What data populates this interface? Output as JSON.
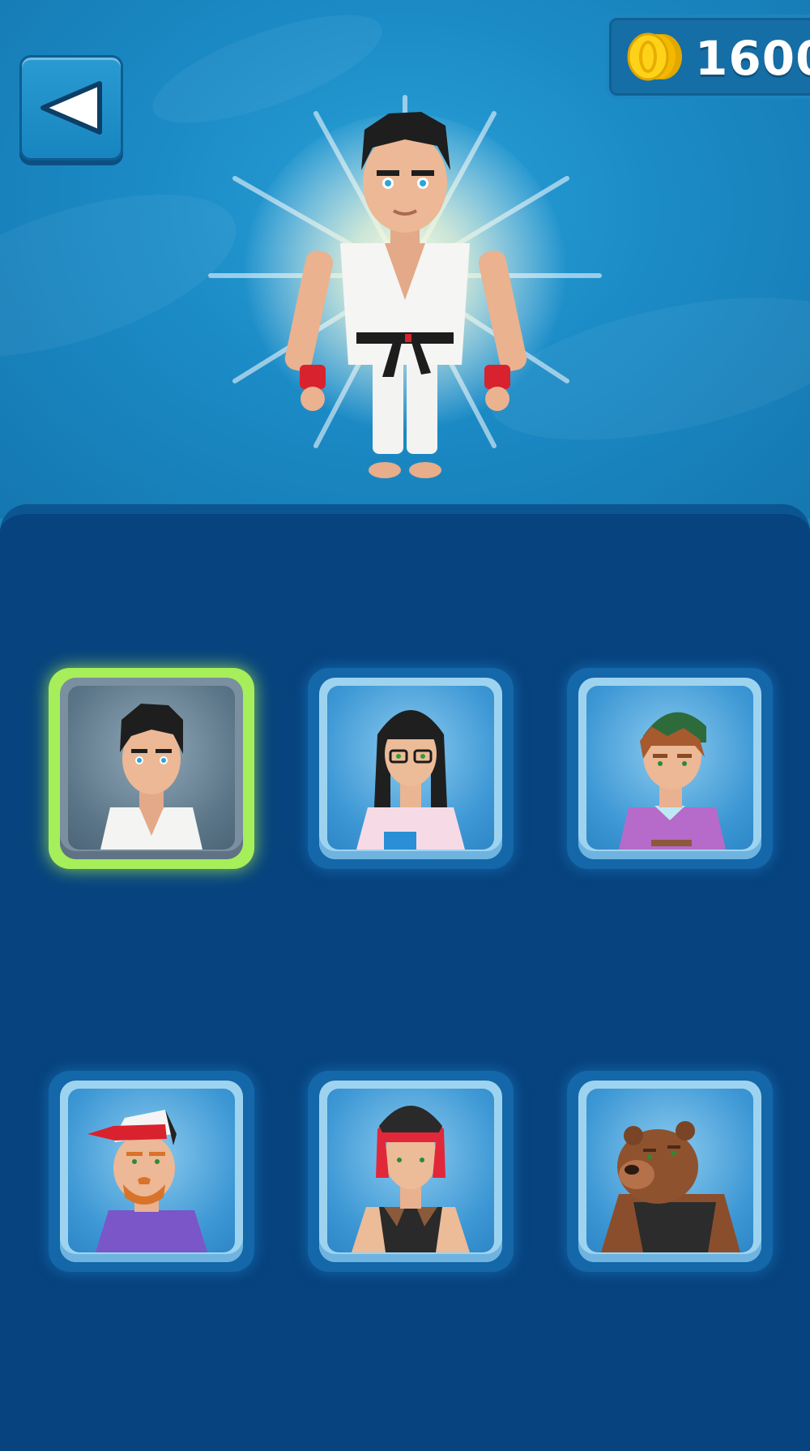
{
  "header": {
    "back_icon": "back-arrow-icon",
    "coins": {
      "icon": "coin-stack-icon",
      "value": "1600"
    }
  },
  "preview": {
    "character": "karate-fighter",
    "effect": "light-burst"
  },
  "character_grid": {
    "selected_index": 0,
    "items": [
      {
        "id": "karate-fighter",
        "selected": true
      },
      {
        "id": "glasses-woman",
        "selected": false
      },
      {
        "id": "green-cap-man",
        "selected": false
      },
      {
        "id": "red-cap-bearded-man",
        "selected": false
      },
      {
        "id": "red-hood-woman",
        "selected": false
      },
      {
        "id": "bear",
        "selected": false
      }
    ]
  },
  "colors": {
    "background_top": "#1b8bc6",
    "panel": "#07437e",
    "selected_border": "#a6ee5a",
    "coin": "#f5c400"
  }
}
